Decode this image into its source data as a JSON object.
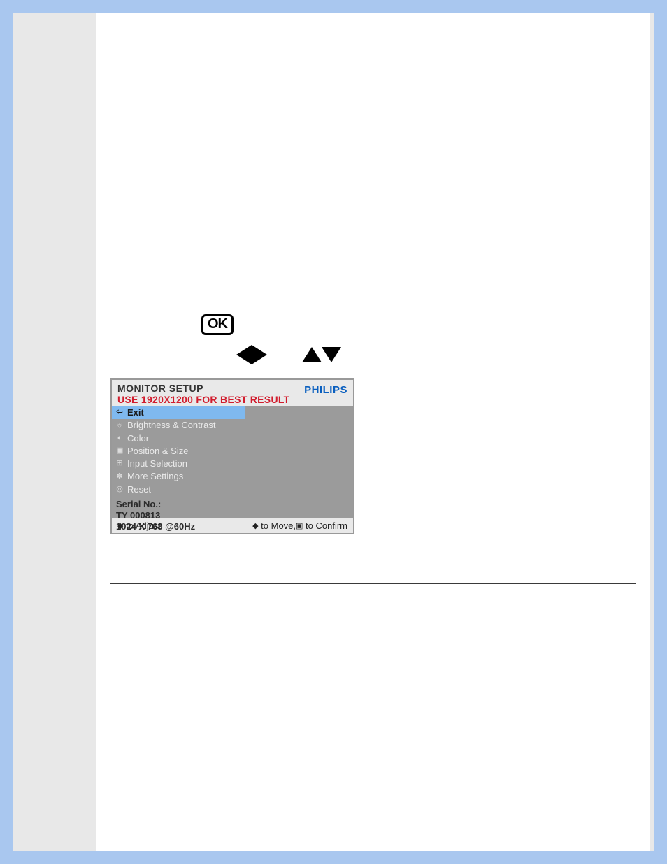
{
  "buttons": {
    "ok_label": "OK"
  },
  "osd": {
    "title": "MONITOR SETUP",
    "subtitle": "USE 1920X1200 FOR BEST RESULT",
    "brand": "PHILIPS",
    "menu": [
      {
        "icon": "⇦",
        "label": "Exit",
        "selected": true
      },
      {
        "icon": "☼",
        "label": "Brightness & Contrast",
        "selected": false
      },
      {
        "icon": "◐",
        "label": "Color",
        "selected": false
      },
      {
        "icon": "▣",
        "label": "Position & Size",
        "selected": false
      },
      {
        "icon": "⊞",
        "label": "Input Selection",
        "selected": false
      },
      {
        "icon": "✽",
        "label": "More Settings",
        "selected": false
      },
      {
        "icon": "◎",
        "label": "Reset",
        "selected": false
      }
    ],
    "info": {
      "serial_label": "Serial No.:",
      "serial_value": "TY 000813",
      "mode_value": "1024 X 768 @60Hz"
    },
    "footer": {
      "left_sym": "◆",
      "left_text": " to Adjust",
      "right_sym1": "◆",
      "right_text1": " to Move,",
      "right_sym2": "▣",
      "right_text2": " to Confirm"
    }
  }
}
